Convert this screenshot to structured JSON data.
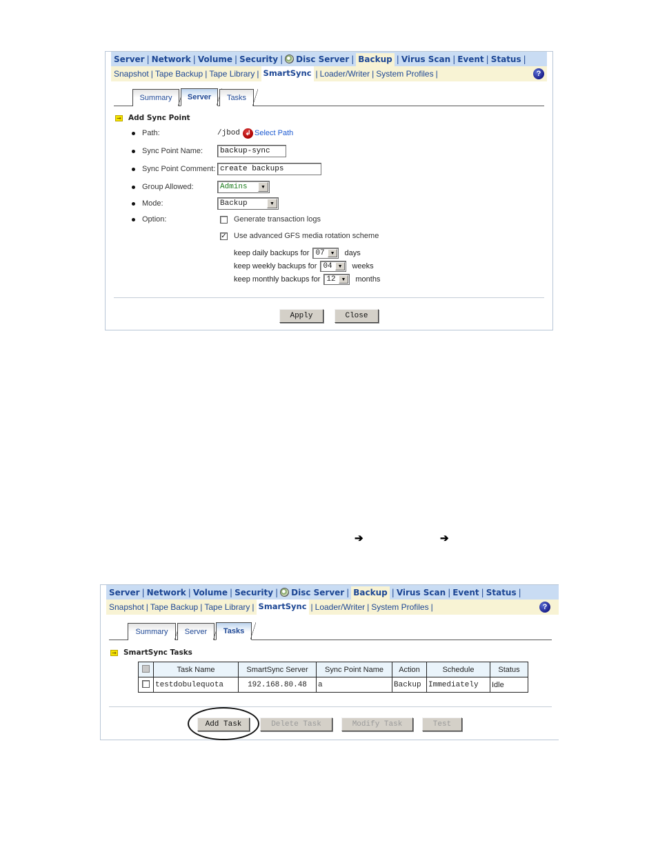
{
  "nav": {
    "top_items": [
      "Server",
      "Network",
      "Volume",
      "Security",
      "Disc Server",
      "Backup",
      "Virus Scan",
      "Event",
      "Status"
    ],
    "top_active": "Backup",
    "sub_items": [
      "Snapshot",
      "Tape Backup",
      "Tape Library",
      "SmartSync",
      "Loader/Writer",
      "System Profiles"
    ],
    "sub_active": "SmartSync",
    "separator": "|",
    "help_icon": "?"
  },
  "panel1": {
    "tabs": [
      "Summary",
      "Server",
      "Tasks"
    ],
    "active_tab": "Server",
    "section_title": "Add Sync Point",
    "fields": {
      "path": {
        "label": "Path:",
        "value": "/jbod",
        "link": "Select Path"
      },
      "sync_point_name": {
        "label": "Sync Point Name:",
        "value": "backup-sync"
      },
      "sync_point_comment": {
        "label": "Sync Point Comment:",
        "value": "create backups"
      },
      "group_allowed": {
        "label": "Group Allowed:",
        "value": "Admins"
      },
      "mode": {
        "label": "Mode:",
        "value": "Backup"
      },
      "option": {
        "label": "Option:"
      }
    },
    "options": {
      "transaction_logs": {
        "label": "Generate transaction logs",
        "checked": false
      },
      "gfs": {
        "label": "Use advanced GFS media rotation scheme",
        "checked": true
      }
    },
    "gfs": {
      "daily": {
        "prefix": "keep daily backups for",
        "value": "07",
        "suffix": "days"
      },
      "weekly": {
        "prefix": "keep weekly backups for",
        "value": "04",
        "suffix": "weeks"
      },
      "monthly": {
        "prefix": "keep monthly backups for",
        "value": "12",
        "suffix": "months"
      }
    },
    "buttons": {
      "apply": "Apply",
      "close": "Close"
    }
  },
  "flow_arrows": [
    "➔",
    "➔"
  ],
  "panel2": {
    "tabs": [
      "Summary",
      "Server",
      "Tasks"
    ],
    "active_tab": "Tasks",
    "section_title": "SmartSync Tasks",
    "table": {
      "columns": [
        "Task Name",
        "SmartSync Server",
        "Sync Point Name",
        "Action",
        "Schedule",
        "Status"
      ],
      "rows": [
        {
          "task_name": "testdobulequota",
          "server": "192.168.80.48",
          "sync_point": "a",
          "action": "Backup",
          "schedule": "Immediately",
          "status": "Idle",
          "checked": false
        }
      ]
    },
    "buttons": {
      "add": "Add Task",
      "delete": "Delete Task",
      "modify": "Modify Task",
      "test": "Test"
    },
    "disabled_buttons": [
      "Delete Task",
      "Modify Task",
      "Test"
    ]
  },
  "colors": {
    "nav_blue": "#c9dcf3",
    "nav_cream": "#f8f3d4",
    "link_blue": "#1c4694",
    "table_header": "#eaf4fb"
  }
}
